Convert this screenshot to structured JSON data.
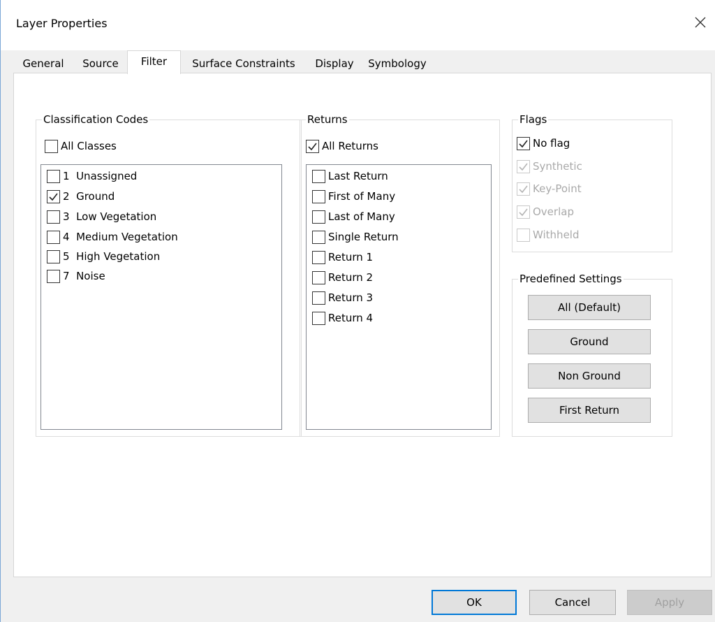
{
  "window": {
    "title": "Layer Properties"
  },
  "tabs": [
    {
      "label": "General",
      "active": false
    },
    {
      "label": "Source",
      "active": false
    },
    {
      "label": "Filter",
      "active": true
    },
    {
      "label": "Surface Constraints",
      "active": false
    },
    {
      "label": "Display",
      "active": false
    },
    {
      "label": "Symbology",
      "active": false
    }
  ],
  "classification": {
    "legend": "Classification Codes",
    "all_label": "All Classes",
    "all_checked": false,
    "items": [
      {
        "label": "1  Unassigned",
        "checked": false
      },
      {
        "label": "2  Ground",
        "checked": true
      },
      {
        "label": "3  Low Vegetation",
        "checked": false
      },
      {
        "label": "4  Medium Vegetation",
        "checked": false
      },
      {
        "label": "5  High Vegetation",
        "checked": false
      },
      {
        "label": "7  Noise",
        "checked": false
      }
    ]
  },
  "returns": {
    "legend": "Returns",
    "all_label": "All Returns",
    "all_checked": true,
    "items": [
      {
        "label": "Last Return",
        "checked": false
      },
      {
        "label": "First of Many",
        "checked": false
      },
      {
        "label": "Last of Many",
        "checked": false
      },
      {
        "label": "Single Return",
        "checked": false
      },
      {
        "label": "Return 1",
        "checked": false
      },
      {
        "label": "Return 2",
        "checked": false
      },
      {
        "label": "Return 3",
        "checked": false
      },
      {
        "label": "Return 4",
        "checked": false
      }
    ]
  },
  "flags": {
    "legend": "Flags",
    "items": [
      {
        "label": "No flag",
        "checked": true,
        "enabled": true
      },
      {
        "label": "Synthetic",
        "checked": true,
        "enabled": false
      },
      {
        "label": "Key-Point",
        "checked": true,
        "enabled": false
      },
      {
        "label": "Overlap",
        "checked": true,
        "enabled": false
      },
      {
        "label": "Withheld",
        "checked": false,
        "enabled": false
      }
    ]
  },
  "predefined": {
    "legend": "Predefined Settings",
    "buttons": [
      "All (Default)",
      "Ground",
      "Non Ground",
      "First Return"
    ]
  },
  "footer": {
    "ok_label": "OK",
    "cancel_label": "Cancel",
    "apply_label": "Apply"
  },
  "colors": {
    "window_border": "#7aa6d6",
    "default_button_border": "#0078d7",
    "disabled_text": "#a9a9a9"
  },
  "icons": {
    "close": "close-icon",
    "check": "checkmark-icon"
  }
}
